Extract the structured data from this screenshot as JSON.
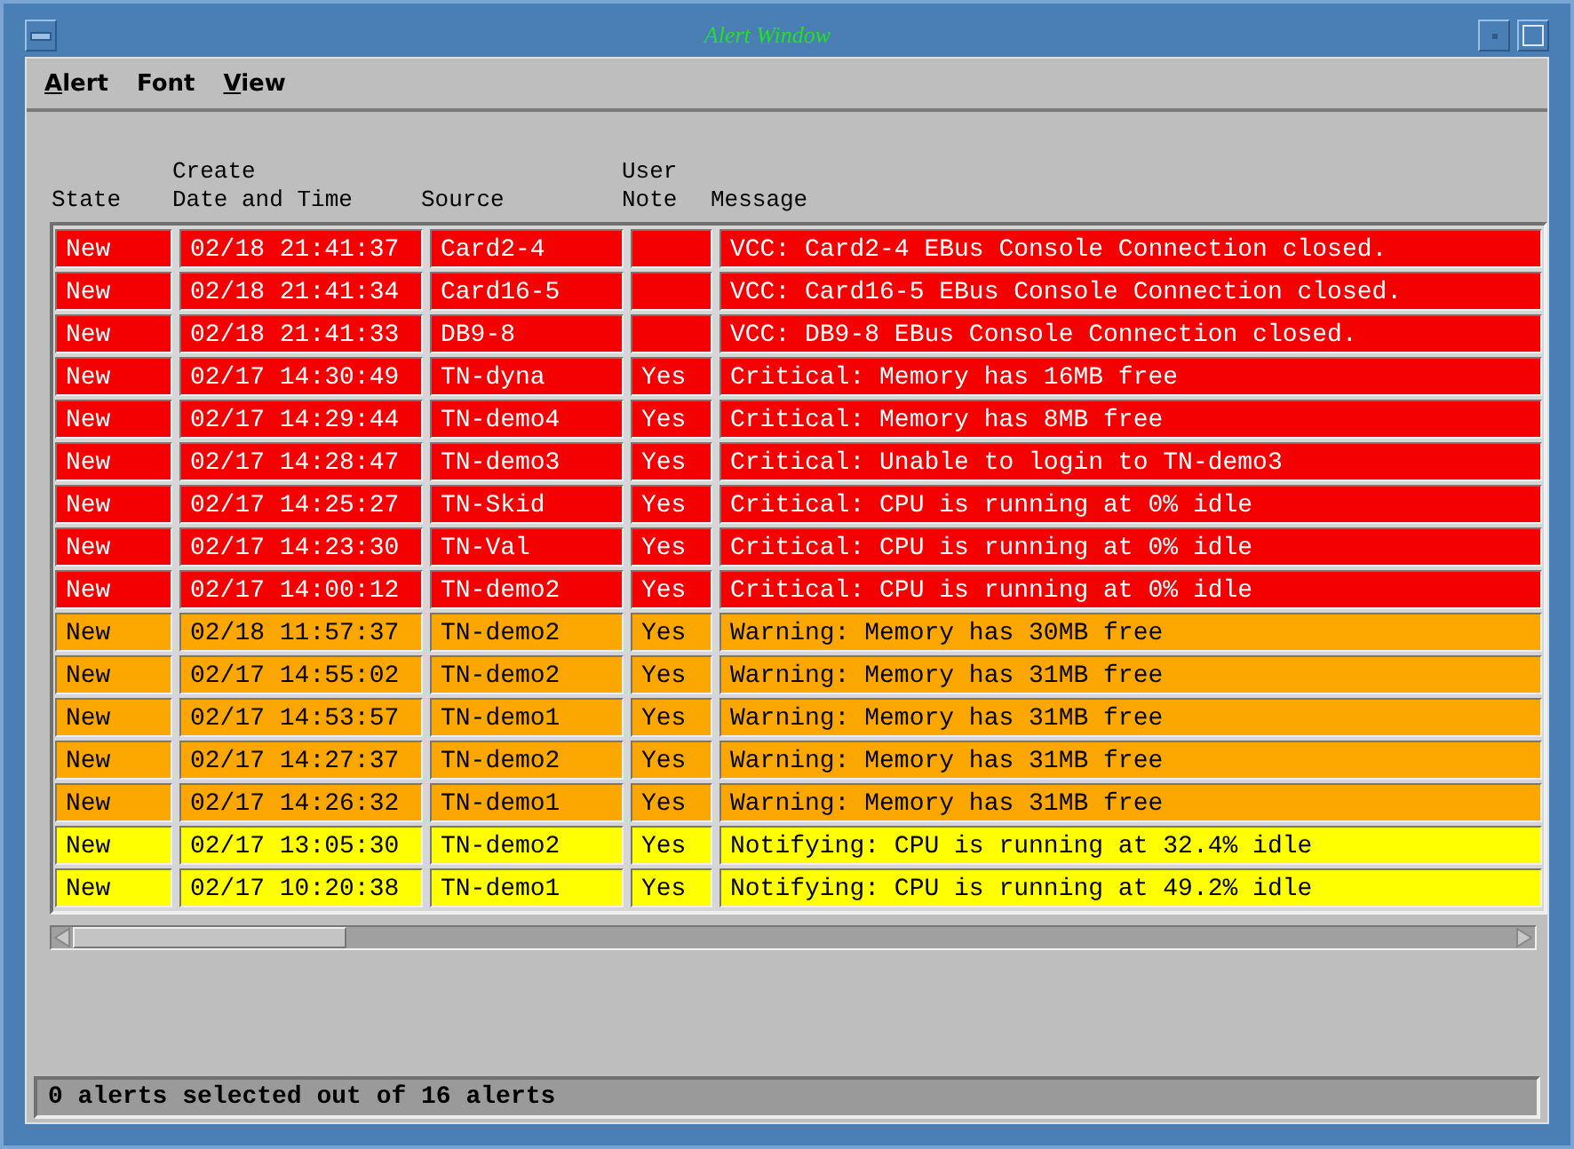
{
  "window": {
    "title": "Alert Window"
  },
  "menu": [
    {
      "label": "Alert",
      "first_letter_underlined": true
    },
    {
      "label": "Font",
      "first_letter_underlined": false
    },
    {
      "label": "View",
      "first_letter_underlined": true
    }
  ],
  "columns": [
    {
      "lines": [
        "State"
      ]
    },
    {
      "lines": [
        "Create",
        "Date and Time"
      ]
    },
    {
      "lines": [
        "Source"
      ]
    },
    {
      "lines": [
        "User",
        "Note"
      ]
    },
    {
      "lines": [
        "Message"
      ]
    }
  ],
  "rows": [
    {
      "kind": "critical",
      "state": "New",
      "time": "02/18 21:41:37",
      "source": "Card2-4",
      "message": "VCC: Card2-4 EBus Console Connection closed."
    },
    {
      "kind": "critical",
      "state": "New",
      "time": "02/18 21:41:34",
      "source": "Card16-5",
      "message": "VCC: Card16-5 EBus Console Connection closed."
    },
    {
      "kind": "critical",
      "state": "New",
      "time": "02/18 21:41:33",
      "source": "DB9-8",
      "message": "VCC: DB9-8 EBus Console Connection closed."
    },
    {
      "kind": "critical",
      "state": "New",
      "time": "02/17 14:30:49",
      "source": "TN-dyna",
      "note": "Yes",
      "message": "Critical: Memory has 16MB free"
    },
    {
      "kind": "critical",
      "state": "New",
      "time": "02/17 14:29:44",
      "source": "TN-demo4",
      "note": "Yes",
      "message": "Critical: Memory has 8MB free"
    },
    {
      "kind": "critical",
      "state": "New",
      "time": "02/17 14:28:47",
      "source": "TN-demo3",
      "note": "Yes",
      "message": "Critical: Unable to login to TN-demo3"
    },
    {
      "kind": "critical",
      "state": "New",
      "time": "02/17 14:25:27",
      "source": "TN-Skid",
      "note": "Yes",
      "message": "Critical: CPU is running at 0% idle"
    },
    {
      "kind": "critical",
      "state": "New",
      "time": "02/17 14:23:30",
      "source": "TN-Val",
      "note": "Yes",
      "message": "Critical: CPU is running at 0% idle"
    },
    {
      "kind": "critical",
      "state": "New",
      "time": "02/17 14:00:12",
      "source": "TN-demo2",
      "note": "Yes",
      "message": "Critical: CPU is running at 0% idle"
    },
    {
      "kind": "warning",
      "state": "New",
      "time": "02/18 11:57:37",
      "source": "TN-demo2",
      "note": "Yes",
      "message": "Warning: Memory has 30MB free"
    },
    {
      "kind": "warning",
      "state": "New",
      "time": "02/17 14:55:02",
      "source": "TN-demo2",
      "note": "Yes",
      "message": "Warning: Memory has 31MB free"
    },
    {
      "kind": "warning",
      "state": "New",
      "time": "02/17 14:53:57",
      "source": "TN-demo1",
      "note": "Yes",
      "message": "Warning: Memory has 31MB free"
    },
    {
      "kind": "warning",
      "state": "New",
      "time": "02/17 14:27:37",
      "source": "TN-demo2",
      "note": "Yes",
      "message": "Warning: Memory has 31MB free"
    },
    {
      "kind": "warning",
      "state": "New",
      "time": "02/17 14:26:32",
      "source": "TN-demo1",
      "note": "Yes",
      "message": "Warning: Memory has 31MB free"
    },
    {
      "kind": "notify",
      "state": "New",
      "time": "02/17 13:05:30",
      "source": "TN-demo2",
      "note": "Yes",
      "message": "Notifying: CPU is running at 32.4% idle"
    },
    {
      "kind": "notify",
      "state": "New",
      "time": "02/17 10:20:38",
      "source": "TN-demo1",
      "note": "Yes",
      "message": "Notifying: CPU is running at 49.2% idle"
    }
  ],
  "status_bar": "0 alerts selected out of 16 alerts"
}
